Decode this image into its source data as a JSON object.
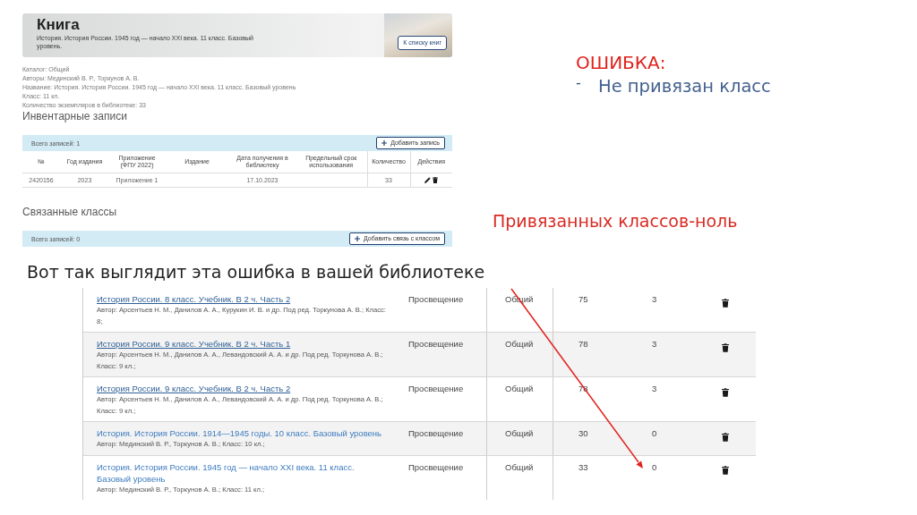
{
  "book_page": {
    "banner": {
      "title": "Книга",
      "subtitle": "История. История России. 1945 год — начало XXI века. 11 класс. Базовый уровень.",
      "button": "К списку книг"
    },
    "details": [
      "Каталог: Общий",
      "Авторы: Мединский В. Р., Торкунов А. В.",
      "Название: История. История России. 1945 год — начало XXI века. 11 класс. Базовый уровень",
      "Класс: 11 кл.",
      "Количество экземпляров в библиотеке: 33"
    ],
    "inventory": {
      "heading": "Инвентарные записи",
      "total": "Всего записей: 1",
      "add_button": "Добавить запись",
      "columns": [
        "№",
        "Год издания",
        "Приложение (ФПУ 2022)",
        "Издание",
        "Дата получения в библиотеку",
        "Предельный срок использования",
        "Количество",
        "Действия"
      ],
      "rows": [
        {
          "number": "2420156",
          "year": "2023",
          "appendix": "Приложение 1",
          "received": "17.10.2023",
          "quantity": "33"
        }
      ]
    },
    "linked_classes": {
      "heading": "Связанные классы",
      "total": "Всего записей: 0",
      "add_button": "Добавить связь с классом"
    }
  },
  "error_note": {
    "title": "ОШИБКА:",
    "items": [
      {
        "bullet": "-",
        "text": "Не привязан класс"
      }
    ]
  },
  "linked_note": "Привязанных классов-ноль",
  "caption": "Вот так выглядит эта ошибка в вашей библиотеке",
  "library_table": {
    "rows": [
      {
        "title": "История России. 8 класс. Учебник. В 2 ч. Часть 2",
        "underlined": true,
        "author": "Автор: Арсентьев Н. М., Данилов А. А., Курукин И. В. и др. Под ред. Торкунова А. В.; Класс: 8;",
        "cells": [
          "Просвещение",
          "Общий",
          "75",
          "3"
        ]
      },
      {
        "title": "История России. 9 класс. Учебник. В 2 ч. Часть 1",
        "underlined": true,
        "author": "Автор: Арсентьев Н. М., Данилов А. А., Левандовский А. А. и др. Под ред. Торкунова А. В.; Класс: 9 кл.;",
        "cells": [
          "Просвещение",
          "Общий",
          "78",
          "3"
        ]
      },
      {
        "title": "История России. 9 класс. Учебник. В 2 ч. Часть 2",
        "underlined": true,
        "author": "Автор: Арсентьев Н. М., Данилов А. А., Левандовский А. А. и др. Под ред. Торкунова А. В.; Класс: 9 кл.;",
        "cells": [
          "Просвещение",
          "Общий",
          "78",
          "3"
        ]
      },
      {
        "title": "История. История России. 1914—1945 годы. 10 класс. Базовый уровень",
        "underlined": false,
        "author": "Автор: Мединский В. Р., Торкунов А. В.; Класс: 10 кл.;",
        "cells": [
          "Просвещение",
          "Общий",
          "30",
          "0"
        ]
      },
      {
        "title": "История. История России. 1945 год — начало XXI века. 11 класс. Базовый уровень",
        "underlined": false,
        "author": "Автор: Мединский В. Р., Торкунов А. В.; Класс: 11 кл.;",
        "cells": [
          "Просвещение",
          "Общий",
          "33",
          "0"
        ]
      }
    ]
  }
}
